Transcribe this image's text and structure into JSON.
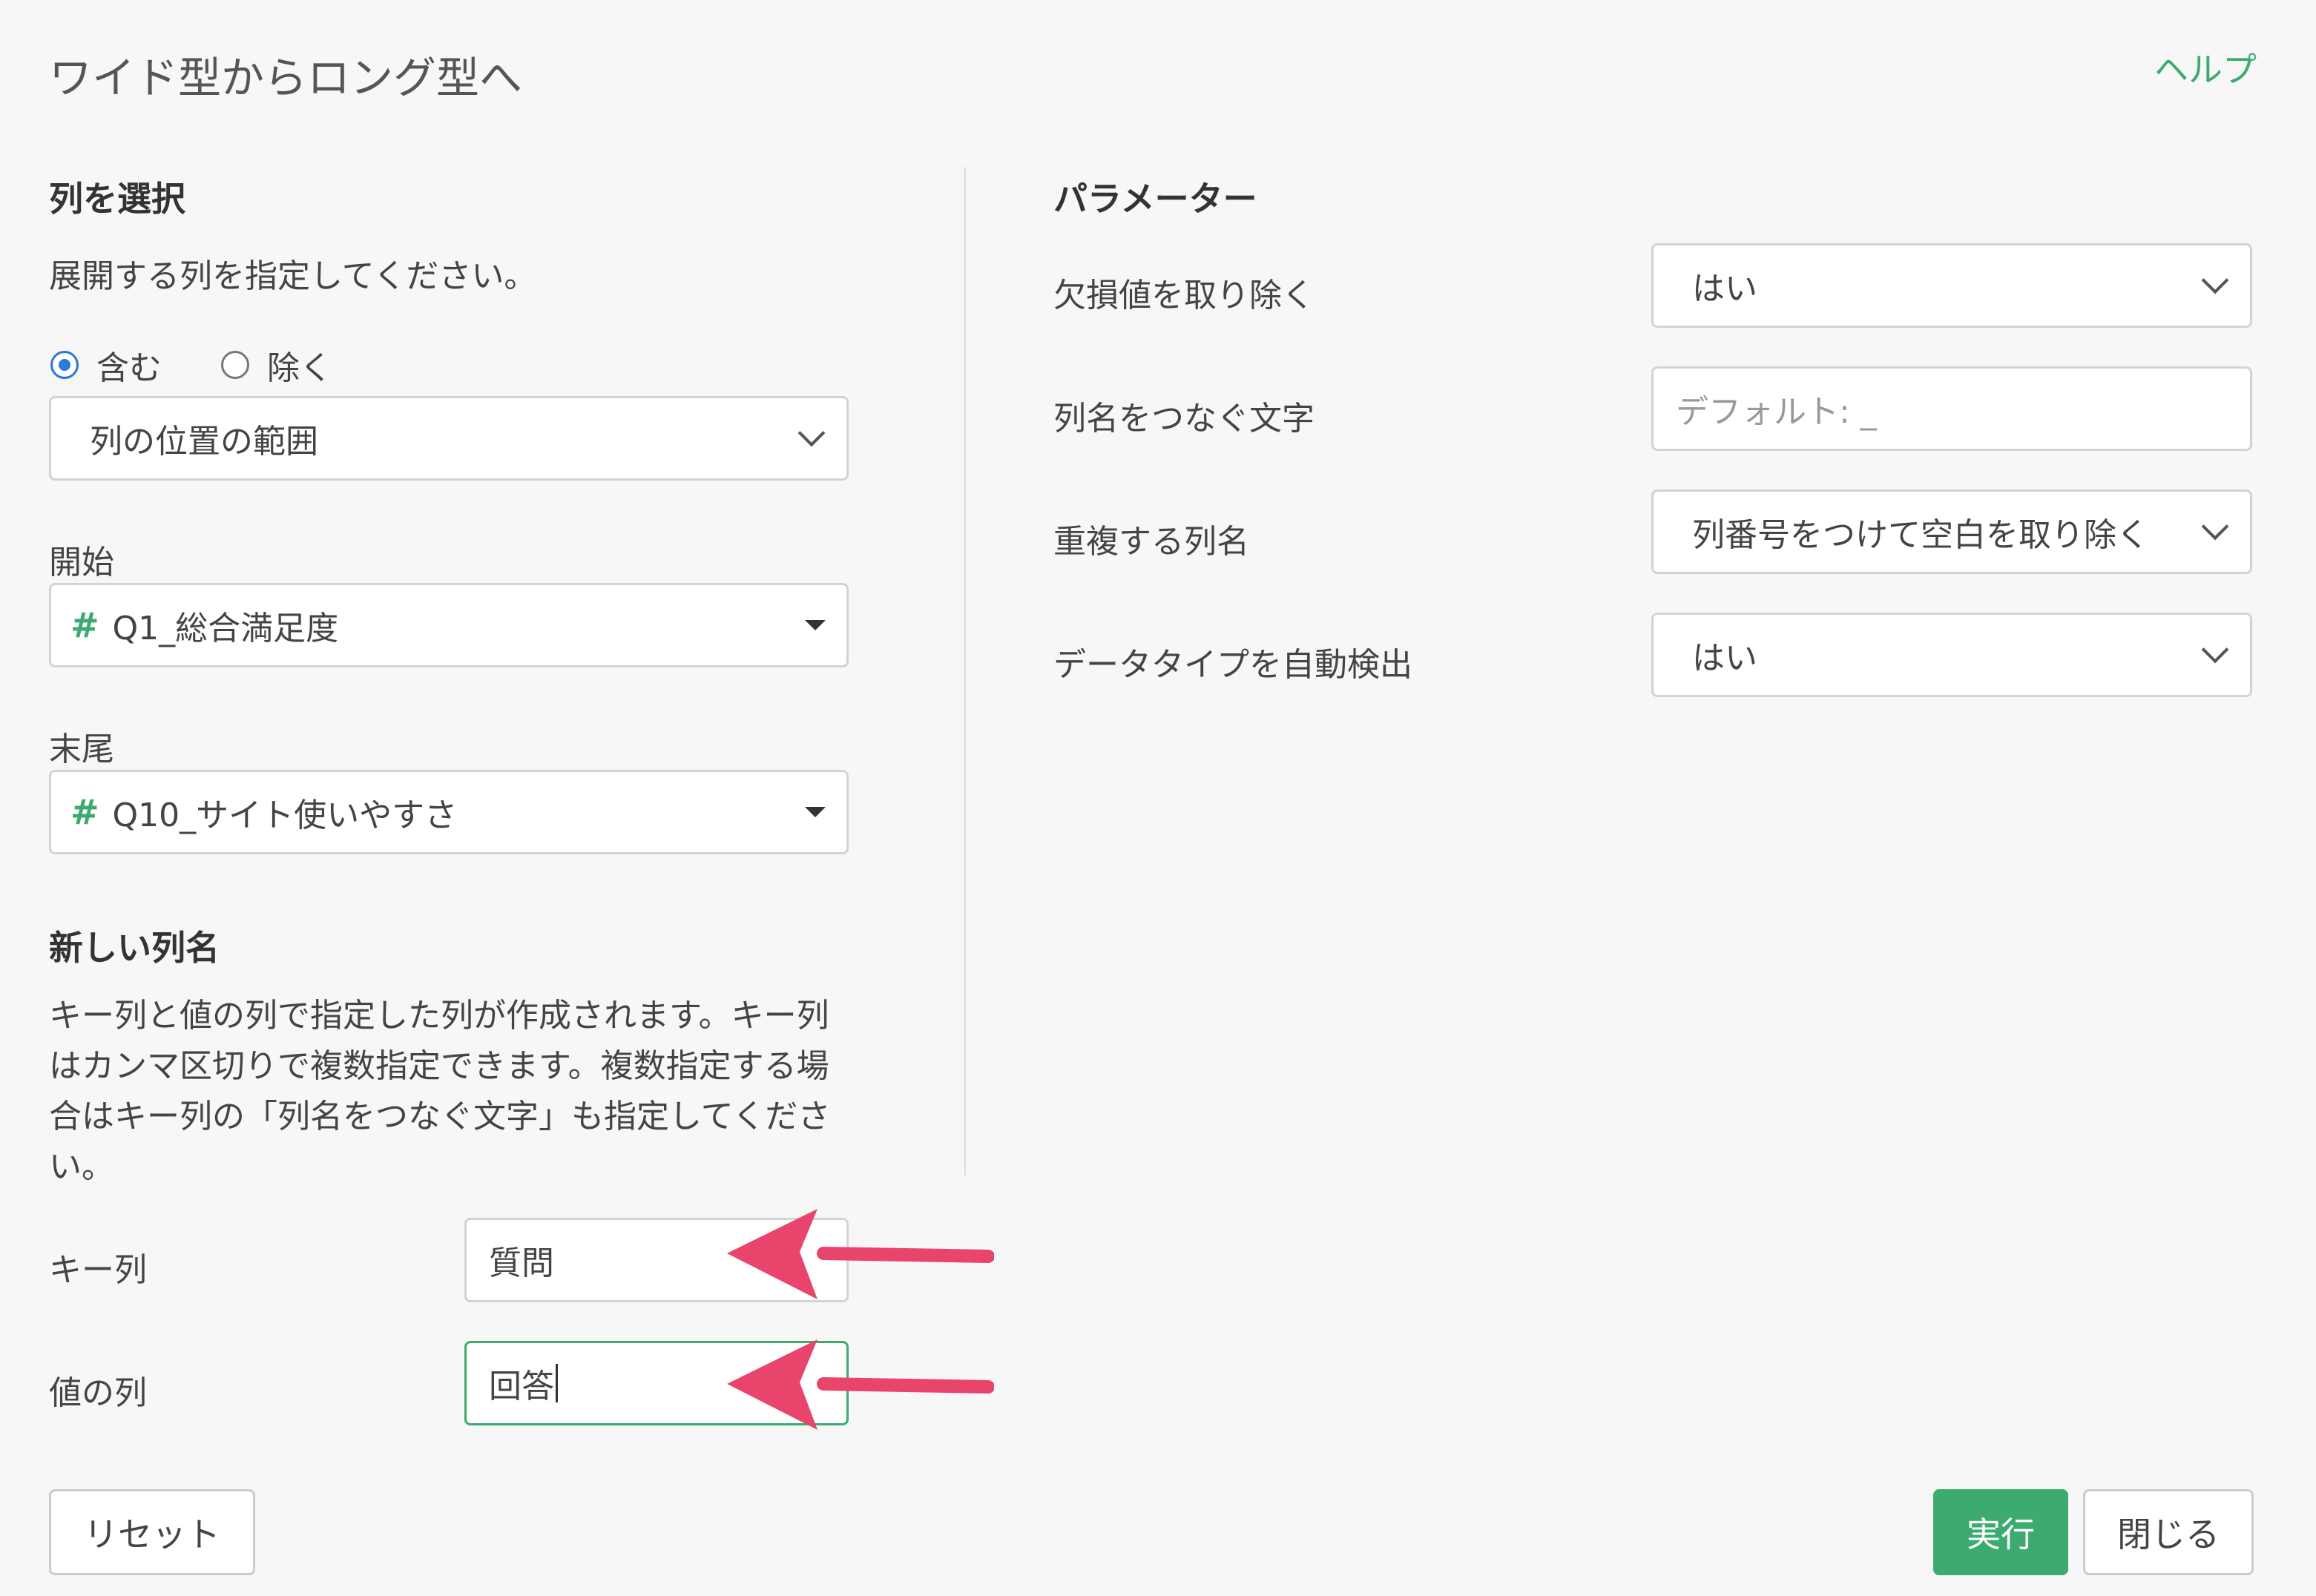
{
  "dialog": {
    "title": "ワイド型からロング型へ",
    "help": "ヘルプ"
  },
  "left": {
    "select_columns": {
      "title": "列を選択",
      "description": "展開する列を指定してください。",
      "include_label": "含む",
      "exclude_label": "除く",
      "mode_value": "列の位置の範囲",
      "start_label": "開始",
      "start_value": "Q1_総合満足度",
      "end_label": "末尾",
      "end_value": "Q10_サイト使いやすさ",
      "hash": "#"
    },
    "new_columns": {
      "title": "新しい列名",
      "description": "キー列と値の列で指定した列が作成されます。キー列はカンマ区切りで複数指定できます。複数指定する場合はキー列の「列名をつなぐ文字」も指定してください。",
      "key_label": "キー列",
      "key_value": "質問",
      "value_label": "値の列",
      "value_value": "回答"
    }
  },
  "right": {
    "parameters": {
      "title": "パラメーター",
      "remove_na_label": "欠損値を取り除く",
      "remove_na_value": "はい",
      "sep_label": "列名をつなぐ文字",
      "sep_placeholder": "デフォルト: _",
      "dup_label": "重複する列名",
      "dup_value": "列番号をつけて空白を取り除く",
      "auto_type_label": "データタイプを自動検出",
      "auto_type_value": "はい"
    }
  },
  "footer": {
    "reset": "リセット",
    "run": "実行",
    "close": "閉じる"
  },
  "colors": {
    "accent": "#3dab6f",
    "annotation_arrow": "#e8446c",
    "radio": "#2a7bd8"
  }
}
